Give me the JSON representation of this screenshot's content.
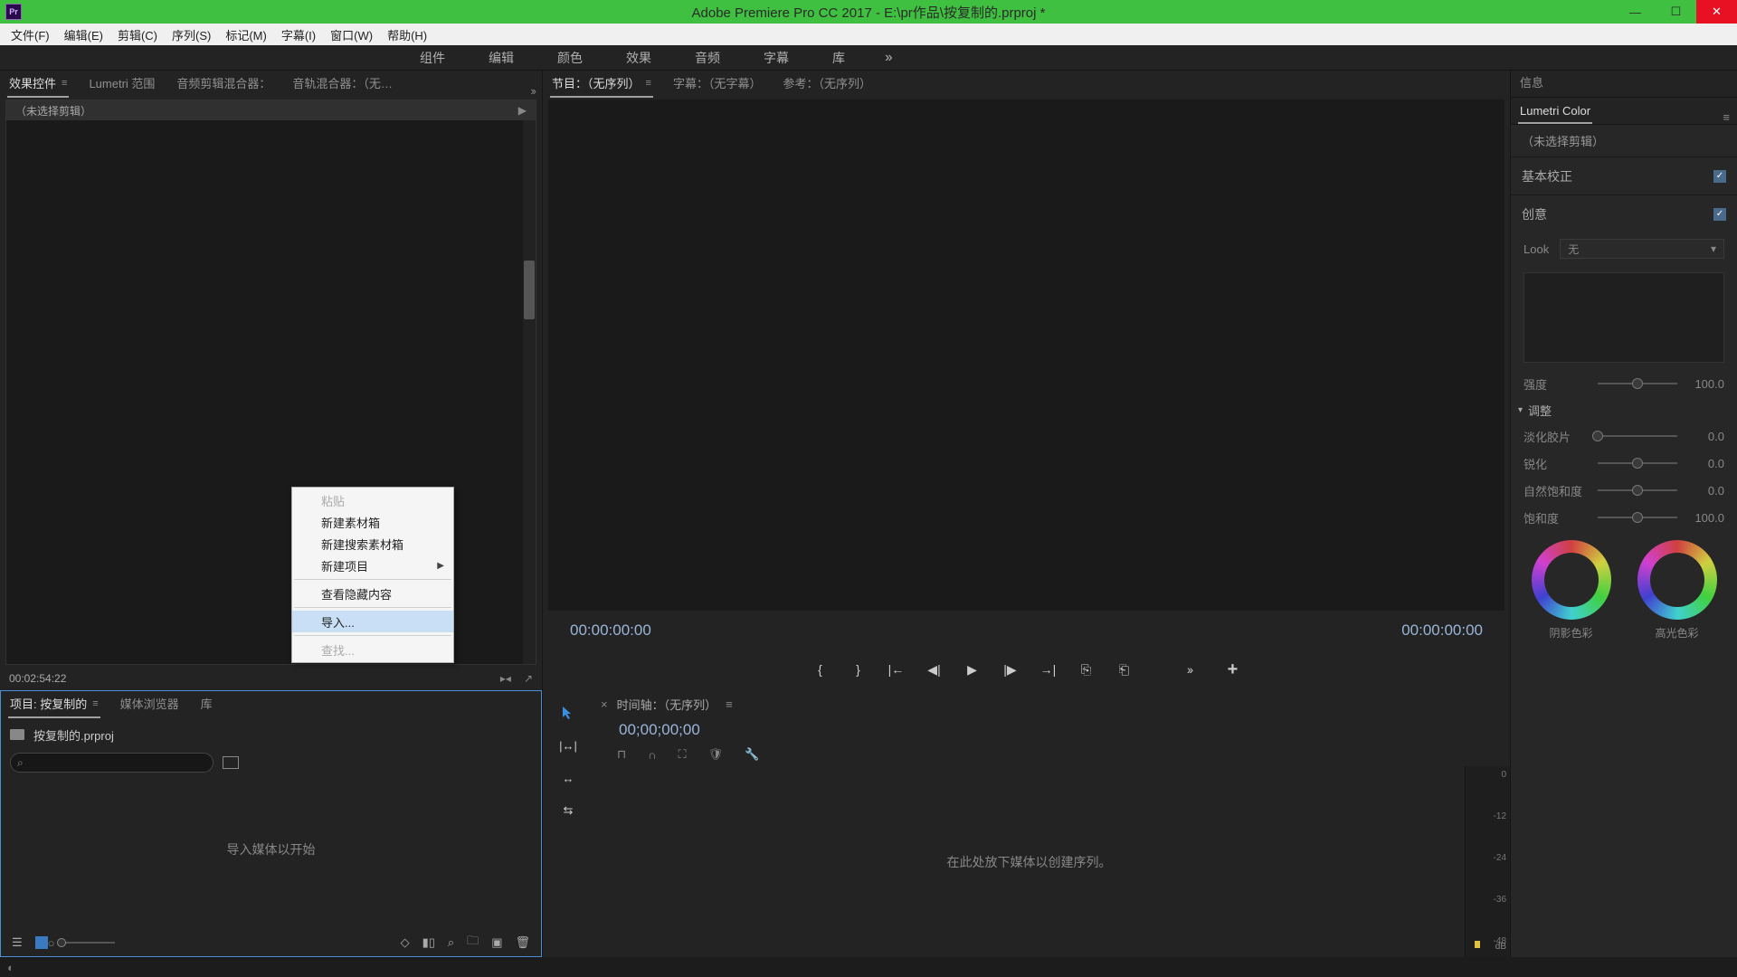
{
  "titlebar": {
    "app_abbrev": "Pr",
    "title": "Adobe Premiere Pro CC 2017 - E:\\pr作品\\按复制的.prproj *"
  },
  "menubar": [
    "文件(F)",
    "编辑(E)",
    "剪辑(C)",
    "序列(S)",
    "标记(M)",
    "字幕(I)",
    "窗口(W)",
    "帮助(H)"
  ],
  "workspaces": [
    "组件",
    "编辑",
    "颜色",
    "效果",
    "音频",
    "字幕",
    "库"
  ],
  "left_top": {
    "tabs": [
      {
        "label": "效果控件",
        "active": true
      },
      {
        "label": "Lumetri 范围",
        "active": false
      },
      {
        "label": "音频剪辑混合器：",
        "active": false
      },
      {
        "label": "音轨混合器：（无…",
        "active": false
      }
    ],
    "no_clip": "（未选择剪辑）",
    "timecode": "00:02:54:22"
  },
  "program": {
    "tabs": [
      {
        "label": "节目：（无序列）",
        "active": true
      },
      {
        "label": "字幕：（无字幕）",
        "active": false
      },
      {
        "label": "参考：（无序列）",
        "active": false
      }
    ],
    "tc_left": "00:00:00:00",
    "tc_right": "00:00:00:00"
  },
  "project": {
    "tabs": [
      {
        "label": "项目: 按复制的",
        "active": true
      },
      {
        "label": "媒体浏览器",
        "active": false
      },
      {
        "label": "库",
        "active": false
      }
    ],
    "filename": "按复制的.prproj",
    "drop_hint": "导入媒体以开始",
    "search_placeholder": ""
  },
  "timeline": {
    "tab": "时间轴：（无序列）",
    "tc": "00;00;00;00",
    "drop_hint": "在此处放下媒体以创建序列。",
    "meter_ticks": [
      0,
      -12,
      -24,
      -36,
      -48
    ],
    "meter_unit": "dB"
  },
  "right": {
    "info_tab": "信息",
    "lumetri_tab": "Lumetri Color",
    "no_clip": "（未选择剪辑）",
    "basic": "基本校正",
    "creative": "创意",
    "look_label": "Look",
    "look_value": "无",
    "intensity": {
      "label": "强度",
      "value": "100.0",
      "pos": 50
    },
    "adjust": "调整",
    "sliders": [
      {
        "label": "淡化胶片",
        "value": "0.0",
        "pos": 0
      },
      {
        "label": "锐化",
        "value": "0.0",
        "pos": 50
      },
      {
        "label": "自然饱和度",
        "value": "0.0",
        "pos": 50
      },
      {
        "label": "饱和度",
        "value": "100.0",
        "pos": 50
      }
    ],
    "wheel_shadow": "阴影色彩",
    "wheel_highlight": "高光色彩"
  },
  "context_menu": {
    "items": [
      {
        "label": "粘贴",
        "disabled": true
      },
      {
        "label": "新建素材箱"
      },
      {
        "label": "新建搜索素材箱"
      },
      {
        "label": "新建项目",
        "submenu": true
      },
      {
        "sep": true
      },
      {
        "label": "查看隐藏内容"
      },
      {
        "sep": true
      },
      {
        "label": "导入...",
        "hover": true
      },
      {
        "sep": true
      },
      {
        "label": "查找...",
        "disabled": true
      }
    ]
  }
}
